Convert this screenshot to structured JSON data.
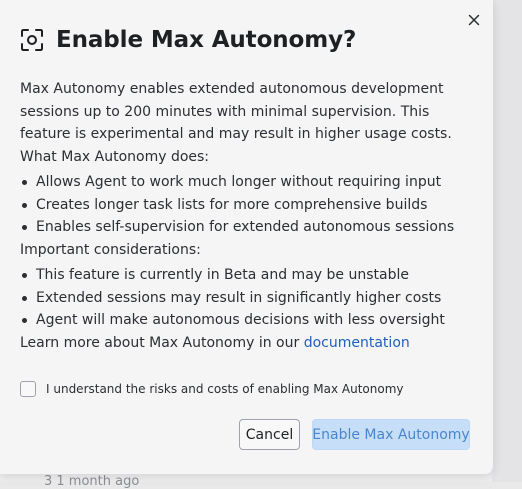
{
  "dialog": {
    "title": "Enable Max Autonomy?",
    "header_icon": "focus-frame-icon",
    "close_icon": "close-icon",
    "intro": "Max Autonomy enables extended autonomous development sessions up to 200 minutes with minimal supervision. This feature is experimental and may result in higher usage costs.",
    "what_heading": "What Max Autonomy does:",
    "what_items": [
      "Allows Agent to work much longer without requiring input",
      "Creates longer task lists for more comprehensive builds",
      "Enables self-supervision for extended autonomous sessions"
    ],
    "considerations_heading": "Important considerations:",
    "considerations_items": [
      "This feature is currently in Beta and may be unstable",
      "Extended sessions may result in significantly higher costs",
      "Agent will make autonomous decisions with less oversight"
    ],
    "learn_more_text": "Learn more about Max Autonomy in our ",
    "learn_more_link": "documentation",
    "checkbox_label": "I understand the risks and costs of enabling Max Autonomy",
    "checkbox_checked": false,
    "cancel_label": "Cancel",
    "enable_label": "Enable Max Autonomy",
    "enable_disabled": true
  },
  "background": {
    "partial_text": "3 1 month ago"
  },
  "colors": {
    "link": "#1f5fbf",
    "primary_disabled_bg": "#c6def8",
    "primary_disabled_text": "#4a86cf",
    "dialog_bg": "#f5f5f6"
  }
}
